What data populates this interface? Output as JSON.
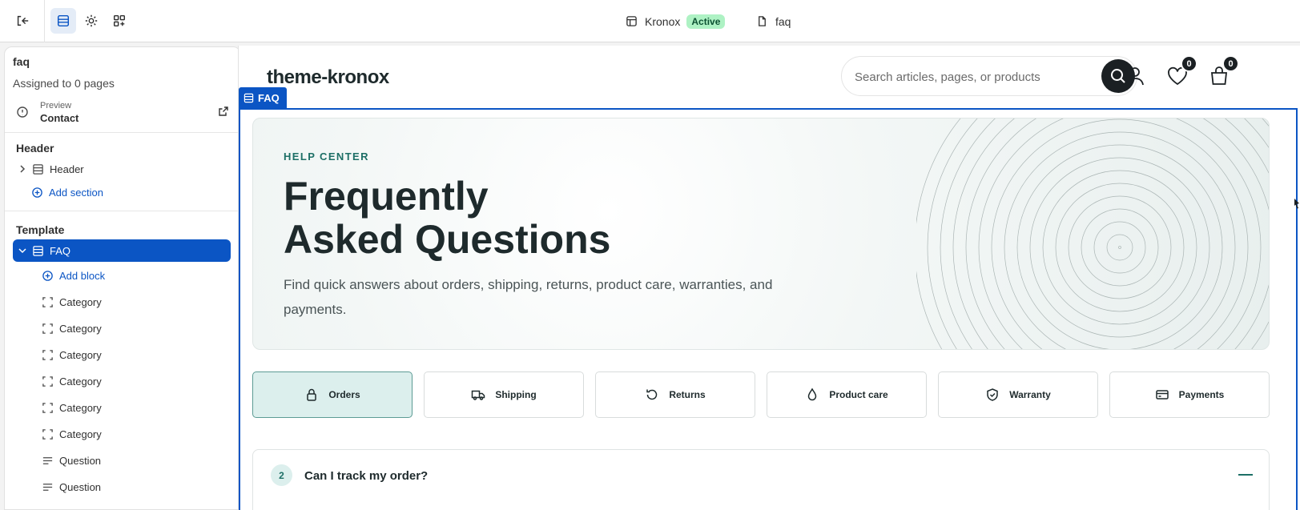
{
  "topbar": {
    "store_name": "Kronox",
    "status": "Active",
    "template_name": "faq",
    "status_color": "#aef2c4"
  },
  "sidebar": {
    "title": "faq",
    "assigned": "Assigned to 0 pages",
    "preview_label": "Preview",
    "preview_value": "Contact",
    "header_group": "Header",
    "header_section": "Header",
    "header_add": "Add section",
    "template_group": "Template",
    "template_section": "FAQ",
    "add_block": "Add block",
    "blocks": [
      "Category",
      "Category",
      "Category",
      "Category",
      "Category",
      "Category",
      "Question",
      "Question"
    ]
  },
  "canvas": {
    "store_title": "theme-kronox",
    "search_placeholder": "Search articles, pages, or products",
    "wishlist_count": "0",
    "cart_count": "0",
    "section_tag": "FAQ",
    "hero": {
      "kicker": "HELP CENTER",
      "title_line1": "Frequently",
      "title_line2": "Asked Questions",
      "description": "Find quick answers about orders, shipping, returns, product care, warranties, and payments."
    },
    "tabs": [
      {
        "label": "Orders",
        "icon": "lock-icon"
      },
      {
        "label": "Shipping",
        "icon": "truck-icon"
      },
      {
        "label": "Returns",
        "icon": "return-icon"
      },
      {
        "label": "Product care",
        "icon": "drop-icon"
      },
      {
        "label": "Warranty",
        "icon": "shield-icon"
      },
      {
        "label": "Payments",
        "icon": "card-icon"
      }
    ],
    "faq": {
      "number": "2",
      "question": "Can I track my order?"
    }
  },
  "colors": {
    "accent": "#0b55c4",
    "brand_teal": "#1d6f66",
    "dark": "#1b2023"
  }
}
